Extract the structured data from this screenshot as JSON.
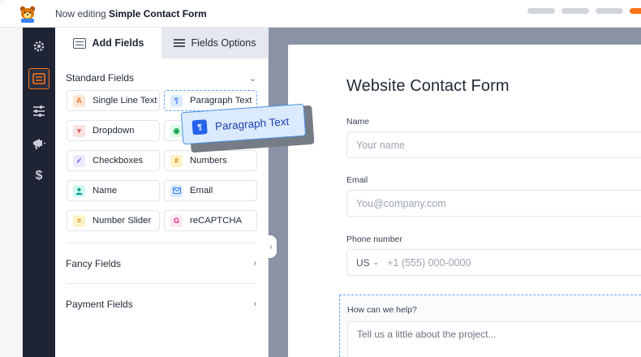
{
  "topbar": {
    "prefix": "Now editing",
    "form_name": "Simple Contact Form",
    "logo_icon": "wpforms-bear-icon"
  },
  "sidebar": {
    "items": [
      {
        "icon": "gear-icon",
        "glyph": "⚙"
      },
      {
        "icon": "fields-icon",
        "glyph": "☰",
        "active": true
      },
      {
        "icon": "sliders-icon",
        "glyph": "⧧"
      },
      {
        "icon": "megaphone-icon",
        "glyph": "📢"
      },
      {
        "icon": "dollar-icon",
        "glyph": "$"
      }
    ]
  },
  "panel": {
    "tabs": [
      {
        "label": "Add Fields",
        "active": true
      },
      {
        "label": "Fields Options",
        "active": false
      }
    ],
    "standard": {
      "title": "Standard Fields",
      "fields": [
        {
          "label": "Single Line Text",
          "glyph": "A",
          "icon": "text-line-icon"
        },
        {
          "label": "Paragraph Text",
          "glyph": "¶",
          "icon": "paragraph-icon"
        },
        {
          "label": "Dropdown",
          "glyph": "▾",
          "icon": "dropdown-icon"
        },
        {
          "label": "",
          "glyph": "◉",
          "icon": "radio-icon"
        },
        {
          "label": "Checkboxes",
          "glyph": "✓",
          "icon": "checkbox-icon"
        },
        {
          "label": "Numbers",
          "glyph": "#",
          "icon": "hash-icon"
        },
        {
          "label": "Name",
          "glyph": "👤",
          "icon": "person-icon"
        },
        {
          "label": "Email",
          "glyph": "✉",
          "icon": "envelope-icon"
        },
        {
          "label": "Number Slider",
          "glyph": "≡",
          "icon": "slider-icon"
        },
        {
          "label": "reCAPTCHA",
          "glyph": "G",
          "icon": "recaptcha-icon"
        }
      ]
    },
    "fancy": {
      "title": "Fancy Fields"
    },
    "payment": {
      "title": "Payment Fields"
    }
  },
  "drag_ghost": {
    "label": "Paragraph Text",
    "glyph": "¶"
  },
  "form": {
    "title": "Website Contact Form",
    "name": {
      "label": "Name",
      "placeholder": "Your name"
    },
    "email": {
      "label": "Email",
      "placeholder": "You@company.com"
    },
    "phone": {
      "label": "Phone number",
      "country": "US",
      "placeholder": "+1 (555) 000-0000"
    },
    "help": {
      "label": "How can we help?",
      "placeholder": "Tell us a little about the project..."
    }
  },
  "colors": {
    "accent": "#f97316",
    "sidebar_bg": "#1e2433",
    "canvas_bg": "#8a93a6",
    "drag_border": "#4a90e2"
  }
}
